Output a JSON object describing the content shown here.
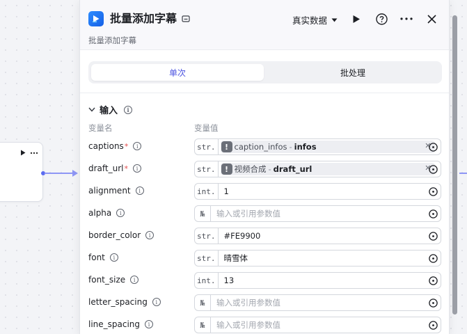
{
  "panel": {
    "title": "批量添加字幕",
    "subtitle": "批量添加字幕",
    "data_mode": "真实数据",
    "tabs": [
      {
        "label": "单次",
        "active": true
      },
      {
        "label": "批处理",
        "active": false
      }
    ]
  },
  "inputs": {
    "section_title": "输入",
    "col_name": "变量名",
    "col_value": "变量值",
    "rows": [
      {
        "name": "captions",
        "required": true,
        "type": "str.",
        "kind": "ref",
        "ref_node": "caption_infos",
        "ref_var": "infos"
      },
      {
        "name": "draft_url",
        "required": true,
        "type": "str.",
        "kind": "ref",
        "ref_node": "视频合成",
        "ref_var": "draft_url"
      },
      {
        "name": "alignment",
        "required": false,
        "type": "int.",
        "kind": "value",
        "value": "1"
      },
      {
        "name": "alpha",
        "required": false,
        "type": "№",
        "kind": "placeholder",
        "value": "输入或引用参数值"
      },
      {
        "name": "border_color",
        "required": false,
        "type": "str.",
        "kind": "value",
        "value": "#FE9900"
      },
      {
        "name": "font",
        "required": false,
        "type": "str.",
        "kind": "value",
        "value": "晴雪体"
      },
      {
        "name": "font_size",
        "required": false,
        "type": "int.",
        "kind": "value",
        "value": "13"
      },
      {
        "name": "letter_spacing",
        "required": false,
        "type": "№",
        "kind": "placeholder",
        "value": "输入或引用参数值"
      },
      {
        "name": "line_spacing",
        "required": false,
        "type": "№",
        "kind": "placeholder",
        "value": "输入或引用参数值"
      }
    ],
    "separator": "-",
    "required_mark": "*"
  },
  "colors": {
    "accent": "#4c54e0",
    "edge": "#8e96f5",
    "required": "#e34d4d"
  },
  "icons": [
    "app-icon",
    "edit-icon",
    "chevron-down-icon",
    "play-icon",
    "help-icon",
    "more-icon",
    "close-icon",
    "collapse-icon",
    "info-icon",
    "warning-icon",
    "clear-icon",
    "variable-icon"
  ]
}
